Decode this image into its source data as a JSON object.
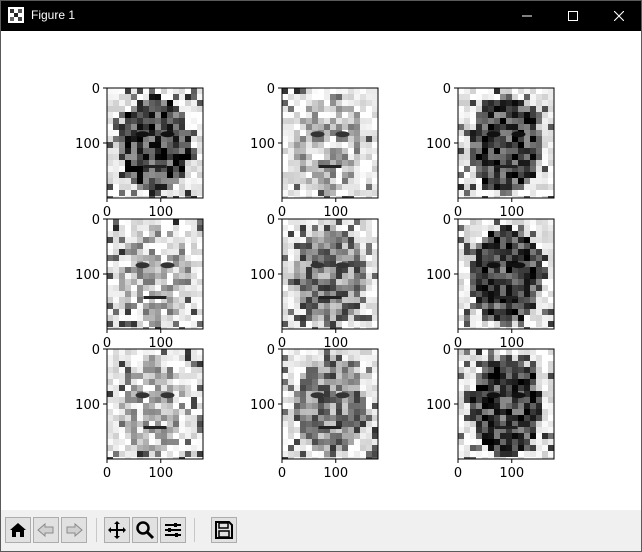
{
  "window": {
    "title": "Figure 1",
    "controls": [
      "minimize",
      "maximize",
      "close"
    ]
  },
  "figure": {
    "subplots": [
      {
        "id": "face-1",
        "tone": "dark"
      },
      {
        "id": "face-2",
        "tone": "light"
      },
      {
        "id": "face-3",
        "tone": "dark"
      },
      {
        "id": "face-4",
        "tone": "light"
      },
      {
        "id": "face-5",
        "tone": "mid"
      },
      {
        "id": "face-6",
        "tone": "dark"
      },
      {
        "id": "face-7",
        "tone": "light"
      },
      {
        "id": "face-8",
        "tone": "mid"
      },
      {
        "id": "face-9",
        "tone": "dark"
      }
    ],
    "y_ticks": [
      "0",
      "100"
    ],
    "x_ticks": [
      "0",
      "100"
    ]
  },
  "chart_data": {
    "type": "image-grid",
    "rows": 3,
    "cols": 3,
    "image_count": 9,
    "colormap": "gray",
    "x_ticks": [
      0,
      100
    ],
    "y_ticks": [
      0,
      100
    ],
    "grid": false
  },
  "toolbar": {
    "buttons": [
      {
        "name": "home",
        "icon": "home-icon"
      },
      {
        "name": "back",
        "icon": "back-arrow-icon"
      },
      {
        "name": "forward",
        "icon": "forward-arrow-icon"
      },
      {
        "name": "pan",
        "icon": "pan-icon"
      },
      {
        "name": "zoom",
        "icon": "zoom-icon"
      },
      {
        "name": "configure-subplots",
        "icon": "sliders-icon"
      },
      {
        "name": "save",
        "icon": "save-icon"
      }
    ]
  }
}
